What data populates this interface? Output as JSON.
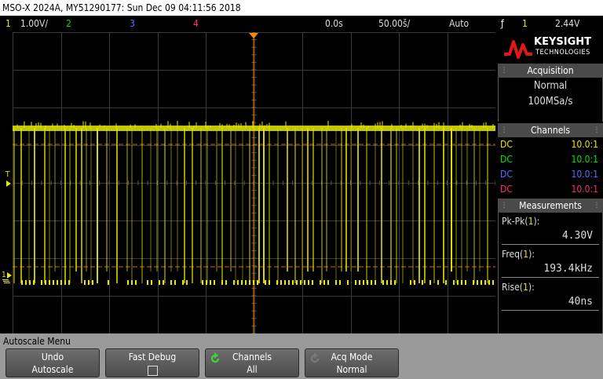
{
  "window": {
    "title": "MSO-X 2024A, MY51290177: Sun Dec 09 04:11:56 2018"
  },
  "status": {
    "ch1_num": "1",
    "ch1_scale": "1.00V/",
    "ch2_num": "2",
    "ch3_num": "3",
    "ch4_num": "4",
    "time_offset": "0.0s",
    "time_scale": "50.00š/",
    "trigger_mode": "Auto",
    "trigger_symbol": "ƒ",
    "trigger_source": "1",
    "trigger_level": "2.44V"
  },
  "scope": {
    "trigger_marker": "T",
    "ch1_ground_marker": "1",
    "colors": {
      "ch1": "#e8e800",
      "ch2": "#00e800",
      "ch3": "#5c6cff",
      "ch4": "#ff2a7a",
      "grid": "#3a3a3a",
      "trigger_line": "#ff8a00"
    }
  },
  "brand": {
    "name": "KEYSIGHT",
    "sub": "TECHNOLOGIES"
  },
  "acquisition": {
    "title": "Acquisition",
    "mode": "Normal",
    "rate": "100MSa/s"
  },
  "channels": {
    "title": "Channels",
    "rows": [
      {
        "coupling": "DC",
        "probe": "10.0:1",
        "color": "#e8e800"
      },
      {
        "coupling": "DC",
        "probe": "10.0:1",
        "color": "#00e800"
      },
      {
        "coupling": "DC",
        "probe": "10.0:1",
        "color": "#5c6cff"
      },
      {
        "coupling": "DC",
        "probe": "10.0:1",
        "color": "#ff2a7a"
      }
    ]
  },
  "measurements": {
    "title": "Measurements",
    "items": [
      {
        "label_prefix": "Pk-Pk(",
        "channel": "1",
        "label_suffix": "):",
        "value": "4.30V"
      },
      {
        "label_prefix": "Freq(",
        "channel": "1",
        "label_suffix": "):",
        "value": "193.4kHz"
      },
      {
        "label_prefix": "Rise(",
        "channel": "1",
        "label_suffix": "):",
        "value": "40ns"
      }
    ]
  },
  "menu": {
    "title": "Autoscale Menu",
    "softkeys": [
      {
        "line1": "Undo",
        "line2": "Autoscale"
      },
      {
        "line1": "Fast Debug",
        "line2": ""
      },
      {
        "line1": "Channels",
        "line2": "All"
      },
      {
        "line1": "Acq Mode",
        "line2": "Normal"
      }
    ]
  }
}
